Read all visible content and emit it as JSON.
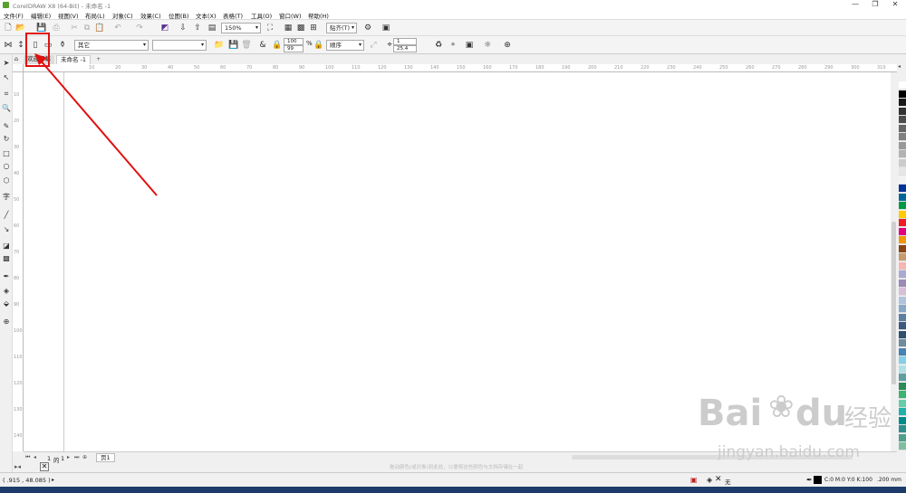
{
  "window": {
    "title": "CorelDRAW X8 (64-Bit) - 未命名 -1",
    "controls": [
      "—",
      "❐",
      "✕"
    ]
  },
  "menubar": [
    "文件(F)",
    "编辑(E)",
    "视图(V)",
    "布局(L)",
    "对象(C)",
    "效果(C)",
    "位图(B)",
    "文本(X)",
    "表格(T)",
    "工具(O)",
    "窗口(W)",
    "帮助(H)"
  ],
  "standard_toolbar": {
    "zoom": "150%",
    "snap_label": "贴齐(T)"
  },
  "property_bar": {
    "page_preset": "其它",
    "page_size_input": "",
    "scale_x": "100",
    "scale_y": "99",
    "scale_unit": "%",
    "mode": "顺序",
    "nudge_count": "1",
    "nudge_value": "25.4"
  },
  "tabs": {
    "welcome": "欢迎屏幕",
    "doc": "未命名 -1",
    "add": "+"
  },
  "rulers": {
    "h_ticks": [
      "10",
      "20",
      "30",
      "40",
      "50",
      "60",
      "70",
      "80",
      "90",
      "100",
      "110",
      "120",
      "130",
      "140",
      "150",
      "160",
      "170",
      "180",
      "190",
      "200",
      "210",
      "220",
      "230",
      "240",
      "250",
      "260",
      "270",
      "280",
      "290",
      "300",
      "310",
      "320"
    ],
    "v_ticks": [
      "10",
      "20",
      "30",
      "40",
      "50",
      "60",
      "70",
      "80",
      "90",
      "100",
      "110",
      "120",
      "130",
      "140"
    ]
  },
  "pagebar": {
    "current": "1",
    "of_label": "的",
    "total": "1",
    "page_tab": "页1"
  },
  "hint": "拖动颜色(或对象)到此处，以便将这些颜色与文档存储在一起",
  "status": {
    "coords": "( .915 , 48.085 )",
    "fill_label": "无",
    "color_info": "C:0 M:0 Y:0 K:100",
    "stroke_width": ".200 mm"
  },
  "palette": [
    "#ffffff",
    "#000000",
    "#1a1a1a",
    "#333333",
    "#4d4d4d",
    "#666666",
    "#808080",
    "#999999",
    "#b3b3b3",
    "#cccccc",
    "#e6e6e6",
    "#f2f2f2",
    "#003399",
    "#006699",
    "#009944",
    "#ffcc00",
    "#ee1c25",
    "#e4007f",
    "#f39800",
    "#8b4513",
    "#c69c6d",
    "#f5b7b1",
    "#a9a9d4",
    "#9c89b8",
    "#d8bfd8",
    "#b0c4de",
    "#87a9c9",
    "#5f7fa0",
    "#3d5a80",
    "#2f4f6f",
    "#6e8b9d",
    "#4682b4",
    "#87ceeb",
    "#b0e0e6",
    "#5f9ea0",
    "#2e8b57",
    "#3cb371",
    "#66cdaa",
    "#20b2aa",
    "#008b8b",
    "#2f8f8f",
    "#4f9f8f",
    "#7fbf9f"
  ],
  "watermark": {
    "brand": "Bai",
    "brand2": "du",
    "cn": "经验",
    "url": "jingyan.baidu.com"
  },
  "colors": {
    "annotation": "#e01010"
  }
}
